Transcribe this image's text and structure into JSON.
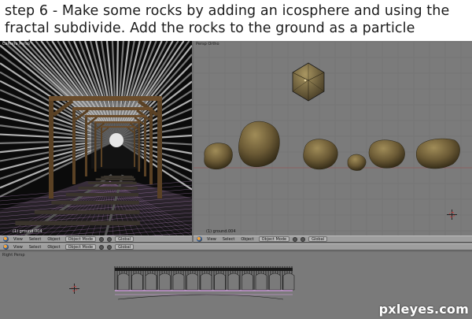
{
  "caption": {
    "line1": "step 6 - Make some rocks by adding an icosphere and using the",
    "line2": "fractal subdivide. Add the rocks to the ground as a particle system."
  },
  "viewports": {
    "left": {
      "title": "Camera Persp",
      "object_label": "(1) ground.004"
    },
    "right": {
      "title": "Persp Ortho",
      "object_label": "(1) ground.004"
    },
    "bottom": {
      "title": "Right Persp"
    }
  },
  "headers": {
    "left": {
      "view": "View",
      "select": "Select",
      "object": "Object",
      "mode": "Object Mode",
      "orientation": "Global"
    },
    "right": {
      "view": "View",
      "select": "Select",
      "object": "Object",
      "mode": "Object Mode",
      "orientation": "Global"
    },
    "bottom": {
      "view": "View",
      "select": "Select",
      "object": "Object",
      "mode": "Object Mode",
      "orientation": "Global"
    }
  },
  "watermark": "pxleyes.com",
  "colors": {
    "rock": "#6b5a35",
    "wire": "#d79ee6",
    "header": "#9e9e9e"
  }
}
